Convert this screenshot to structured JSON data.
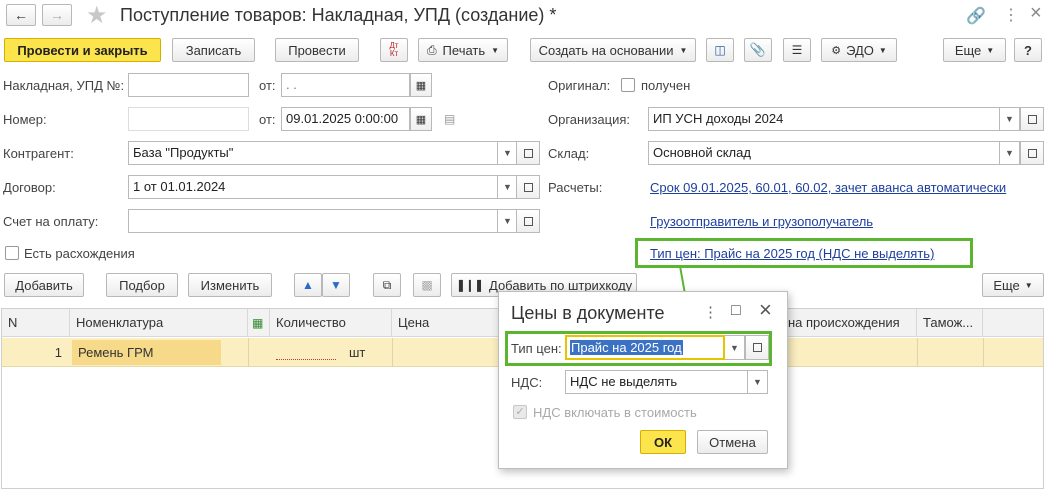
{
  "window": {
    "title": "Поступление товаров: Накладная, УПД (создание) *",
    "more_symbol": "⋮",
    "minimize_symbol": "□",
    "close_symbol": "×"
  },
  "toolbar": {
    "post_close": "Провести и закрыть",
    "save": "Записать",
    "post": "Провести",
    "dtkt_top": "Дт",
    "dtkt_bottom": "Кт",
    "print": "Печать",
    "create_based": "Создать на основании",
    "edo": "ЭДО",
    "more": "Еще",
    "help": "?"
  },
  "form": {
    "invoice_label": "Накладная, УПД №:",
    "invoice_value": "",
    "from_label": "от:",
    "invoice_date": " .  .",
    "number_label": "Номер:",
    "number_value": "",
    "date_label": "от:",
    "date_value": "09.01.2025  0:00:00",
    "counterparty_label": "Контрагент:",
    "counterparty_value": "База \"Продукты\"",
    "contract_label": "Договор:",
    "contract_value": "1 от 01.01.2024",
    "invoice_pay_label": "Счет на оплату:",
    "invoice_pay_value": "",
    "discrepancy_label": "Есть расхождения",
    "original_label": "Оригинал:",
    "original_received": "получен",
    "org_label": "Организация:",
    "org_value": "ИП УСН доходы 2024",
    "warehouse_label": "Склад:",
    "warehouse_value": "Основной склад",
    "settlements_label": "Расчеты:",
    "settlements_link": "Срок 09.01.2025, 60.01, 60.02, зачет аванса автоматически",
    "shipper_link": "Грузоотправитель и грузополучатель",
    "price_type_link": "Тип цен: Прайс на 2025 год (НДС не выделять)"
  },
  "table_toolbar": {
    "add": "Добавить",
    "select": "Подбор",
    "change": "Изменить",
    "barcode": "Добавить по штрихкоду",
    "more": "Еще"
  },
  "table": {
    "headers": {
      "n": "N",
      "item": "Номенклатура",
      "qty": "Количество",
      "price": "Цена",
      "origin": "на происхождения",
      "customs": "Тамож..."
    },
    "rows": [
      {
        "n": "1",
        "item": "Ремень ГРМ",
        "qty": "",
        "unit": "шт"
      }
    ]
  },
  "dialog": {
    "title": "Цены в документе",
    "price_type_label": "Тип цен:",
    "price_type_value": "Прайс на 2025 год",
    "vat_label": "НДС:",
    "vat_value": "НДС не выделять",
    "vat_include_label": "НДС включать в стоимость",
    "ok": "ОК",
    "cancel": "Отмена"
  },
  "colors": {
    "accent_yellow": "#fce44c",
    "highlight_green": "#5bb531",
    "link_blue": "#1e3f9e",
    "row_selected": "#fbeec0"
  }
}
